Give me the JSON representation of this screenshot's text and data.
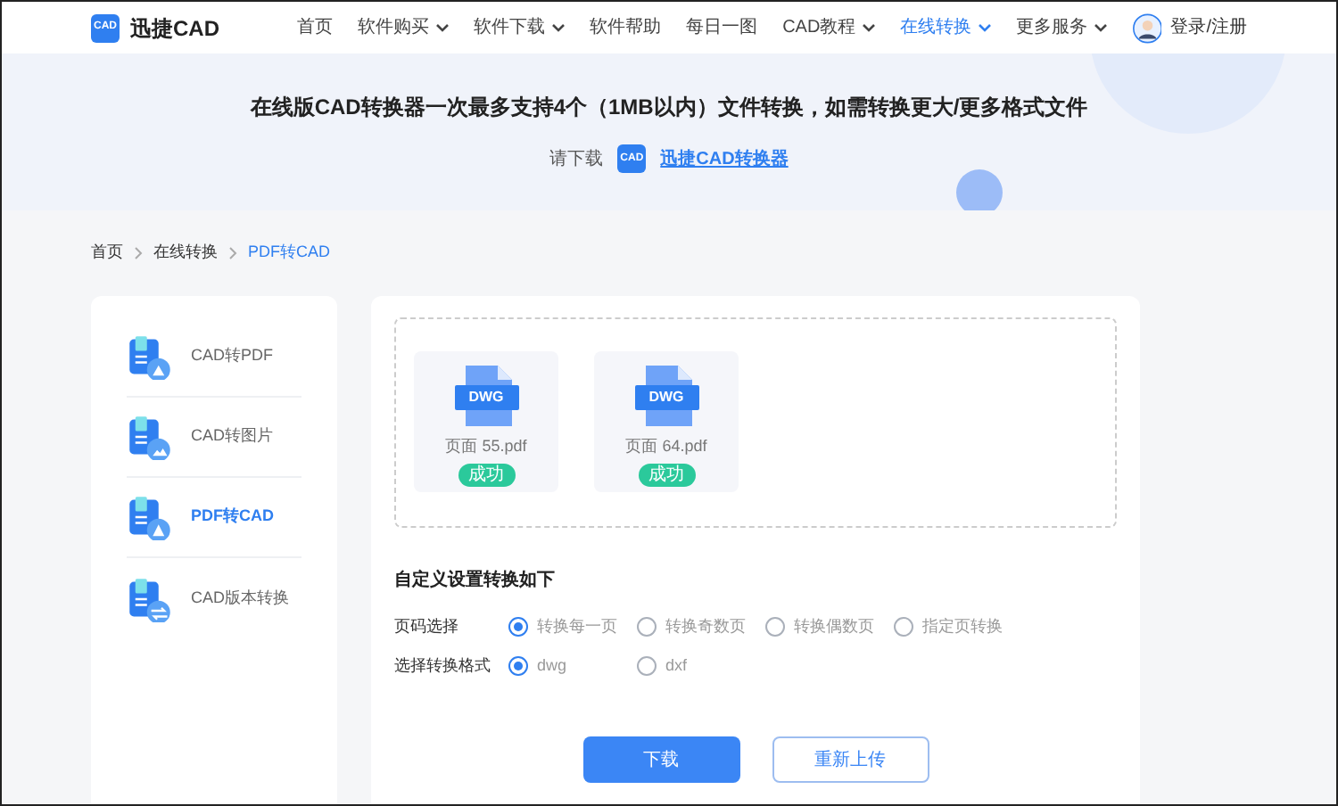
{
  "header": {
    "logo_badge": "CAD",
    "logo_text": "迅捷CAD",
    "nav": [
      {
        "label": "首页",
        "dropdown": false,
        "selected": false
      },
      {
        "label": "软件购买",
        "dropdown": true,
        "selected": false
      },
      {
        "label": "软件下载",
        "dropdown": true,
        "selected": false
      },
      {
        "label": "软件帮助",
        "dropdown": false,
        "selected": false
      },
      {
        "label": "每日一图",
        "dropdown": false,
        "selected": false
      },
      {
        "label": "CAD教程",
        "dropdown": true,
        "selected": false
      },
      {
        "label": "在线转换",
        "dropdown": true,
        "selected": true
      },
      {
        "label": "更多服务",
        "dropdown": true,
        "selected": false
      }
    ],
    "login": "登录/注册"
  },
  "banner": {
    "headline": "在线版CAD转换器一次最多支持4个（1MB以内）文件转换，如需转换更大/更多格式文件",
    "prompt": "请下载",
    "app_badge": "CAD",
    "app_link": "迅捷CAD转换器"
  },
  "breadcrumb": [
    {
      "label": "首页",
      "selected": false
    },
    {
      "label": "在线转换",
      "selected": false
    },
    {
      "label": "PDF转CAD",
      "selected": true
    }
  ],
  "sidebar": {
    "items": [
      {
        "label": "CAD转PDF",
        "kind": "pdf",
        "selected": false
      },
      {
        "label": "CAD转图片",
        "kind": "image",
        "selected": false
      },
      {
        "label": "PDF转CAD",
        "kind": "cad",
        "selected": true
      },
      {
        "label": "CAD版本转换",
        "kind": "version",
        "selected": false
      }
    ]
  },
  "files": [
    {
      "type": "DWG",
      "name": "页面 55.pdf",
      "status": "成功"
    },
    {
      "type": "DWG",
      "name": "页面 64.pdf",
      "status": "成功"
    }
  ],
  "settings": {
    "title": "自定义设置转换如下",
    "groups": [
      {
        "label": "页码选择",
        "options": [
          {
            "label": "转换每一页",
            "selected": true
          },
          {
            "label": "转换奇数页",
            "selected": false
          },
          {
            "label": "转换偶数页",
            "selected": false
          },
          {
            "label": "指定页转换",
            "selected": false
          }
        ]
      },
      {
        "label": "选择转换格式",
        "options": [
          {
            "label": "dwg",
            "selected": true
          },
          {
            "label": "dxf",
            "selected": false
          }
        ]
      }
    ]
  },
  "buttons": {
    "primary": "下载",
    "secondary": "重新上传"
  }
}
